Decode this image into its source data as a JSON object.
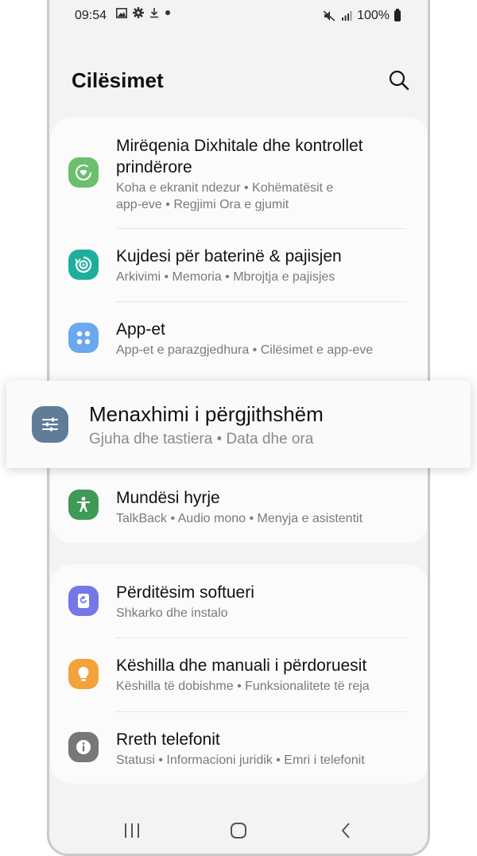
{
  "status_bar": {
    "time": "09:54",
    "battery": "100%",
    "left_icons": [
      "image-icon",
      "gear-icon",
      "download-icon",
      "dot-icon"
    ],
    "right_icons": [
      "mute-icon",
      "signal-icon",
      "battery-icon"
    ]
  },
  "header": {
    "title": "Cilësimet",
    "search_icon": "search-icon"
  },
  "items": [
    {
      "title_line1": "Mirëqenia Dixhitale dhe kontrollet",
      "title_line2": "prindërore",
      "sub_line1": "Koha e ekranit ndezur  •  Kohëmatësit e",
      "sub_line2": "app-eve  •  Regjimi Ora e gjumit",
      "icon": "digital-wellbeing-icon",
      "color": "#6cbf6f"
    },
    {
      "title": "Kujdesi për baterinë & pajisjen",
      "sub": "Arkivimi  •  Memoria  •  Mbrojtja e pajisjes",
      "icon": "device-care-icon",
      "color": "#1fae9b"
    },
    {
      "title": "App-et",
      "sub": "App-et e parazgjedhura  •  Cilësimet e app-eve",
      "icon": "apps-icon",
      "color": "#6aa8f0"
    },
    {
      "title": "Menaxhimi i përgjithshëm",
      "sub": "Gjuha dhe tastiera  •  Data dhe ora",
      "icon": "sliders-icon",
      "color": "#5f7d99"
    },
    {
      "title": "Mundësi hyrje",
      "sub": "TalkBack  •  Audio mono  •  Menyja e asistentit",
      "icon": "accessibility-icon",
      "color": "#3e9a54"
    },
    {
      "title": "Përditësim softueri",
      "sub": "Shkarko dhe instalo",
      "icon": "software-update-icon",
      "color": "#7377e8"
    },
    {
      "title": "Këshilla dhe manuali i përdoruesit",
      "sub": "Këshilla të dobishme  •  Funksionalitete të reja",
      "icon": "lightbulb-icon",
      "color": "#f2a33a"
    },
    {
      "title": "Rreth telefonit",
      "sub": "Statusi  •  Informacioni juridik  •  Emri i telefonit",
      "icon": "info-icon",
      "color": "#777777"
    }
  ],
  "navbar": {
    "recents": "recents-icon",
    "home": "home-icon",
    "back": "back-icon"
  }
}
